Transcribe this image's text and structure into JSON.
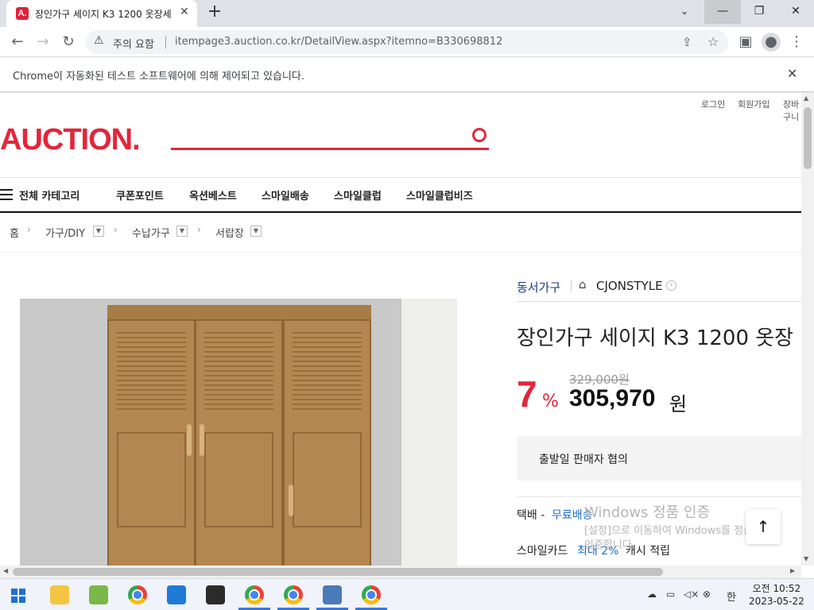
{
  "browser": {
    "tab_title": "장인가구 세이지 K3 1200 옷장세",
    "tab_favicon": "A.",
    "new_tab": "+",
    "addr_warning": "주의 요함",
    "url": "itempage3.auction.co.kr/DetailView.aspx?itemno=B330698812",
    "infobar_text": "Chrome이 자동화된 테스트 소프트웨어에 의해 제어되고 있습니다."
  },
  "header": {
    "top_links": [
      "로그인",
      "회원가입",
      "장바구니"
    ],
    "logo": "AUCTION."
  },
  "nav": {
    "all_category": "전체 카테고리",
    "items": [
      "쿠폰포인트",
      "옥션베스트",
      "스마일배송",
      "스마일클럽",
      "스마일클럽비즈"
    ]
  },
  "breadcrumb": {
    "home": "홈",
    "levels": [
      "가구/DIY",
      "수납가구",
      "서랍장"
    ]
  },
  "product": {
    "seller": "동서가구",
    "brand": "CJONSTYLE",
    "title": "장인가구 세이지 K3 1200 옷장",
    "original_price": "329,000원",
    "discount": "7",
    "discount_unit": "%",
    "price": "305,970",
    "price_unit": "원",
    "ship_date": "출발일 판매자 협의",
    "delivery_label": "택배 -",
    "delivery_value": "무료배송",
    "card_label": "스마일카드",
    "card_value": "최대 2%",
    "card_suffix": "캐시 적립"
  },
  "watermark": {
    "line1": "Windows 정품 인증",
    "line2": "[설정]으로 이동하여 Windows를 정품",
    "line3": "인증합니다."
  },
  "taskbar": {
    "time": "오전 10:52",
    "date": "2023-05-22",
    "ime": "한"
  },
  "colors": {
    "brand_red": "#e4253a",
    "link_blue": "#1a6dcc",
    "seller_navy": "#1a3a8c"
  }
}
